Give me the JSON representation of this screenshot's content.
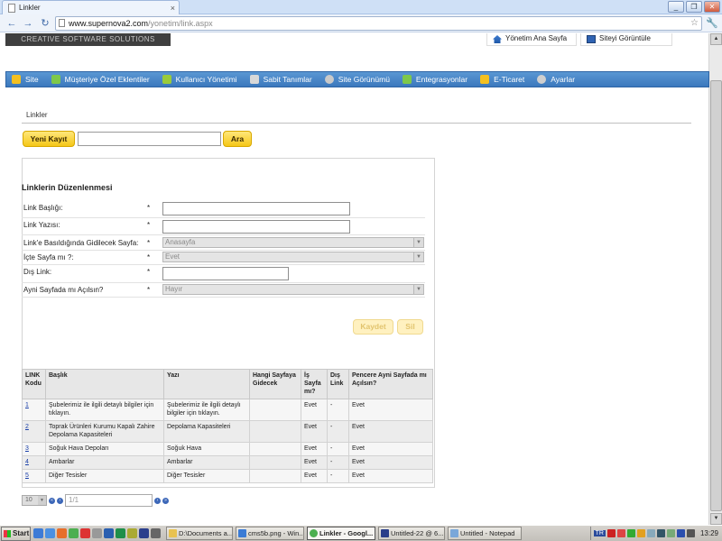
{
  "browser": {
    "tab_title": "Linkler",
    "tab_close": "×",
    "url_domain": "www.supernova2.com",
    "url_path": "/yonetim/link.aspx",
    "window_buttons": [
      "_",
      "❐",
      "✕"
    ]
  },
  "header": {
    "brand": "CREATIVE SOFTWARE SOLUTIONS",
    "admin_home": "Yönetim Ana Sayfa",
    "view_site": "Siteyi Görüntüle"
  },
  "menu": {
    "items": [
      {
        "label": "Site",
        "icon_color": "#f4c020"
      },
      {
        "label": "Müşteriye Özel Eklentiler",
        "icon_color": "#7ec84a"
      },
      {
        "label": "Kullanıcı Yönetimi",
        "icon_color": "#9acb3a"
      },
      {
        "label": "Sabit Tanımlar",
        "icon_color": "#d8d8d8"
      },
      {
        "label": "Site Görünümü",
        "icon_color": "#c9c9c9"
      },
      {
        "label": "Entegrasyonlar",
        "icon_color": "#7ec84a"
      },
      {
        "label": "E-Ticaret",
        "icon_color": "#f4c020"
      },
      {
        "label": "Ayarlar",
        "icon_color": "#cfcfcf"
      }
    ]
  },
  "page": {
    "breadcrumb": "Linkler",
    "new_button": "Yeni Kayıt",
    "search_button": "Ara",
    "search_value": ""
  },
  "form": {
    "title": "Linklerin Düzenlenmesi",
    "link_title_label": "Link Başlığı:",
    "link_text_label": "Link Yazısı:",
    "target_page_label": "Link'e Basıldığında Gidilecek Sayfa:",
    "target_page_value": "Anasayfa",
    "internal_label": "İçte Sayfa mı ?:",
    "internal_value": "Evet",
    "external_label": "Dış Link:",
    "same_window_label": "Ayni Sayfada mı Açılsın?",
    "same_window_value": "Hayır",
    "required_mark": "*",
    "save_button": "Kaydet",
    "delete_button": "Sil"
  },
  "table": {
    "headers": [
      "LINK Kodu",
      "Başlık",
      "Yazı",
      "Hangi Sayfaya Gidecek",
      "İş Sayfa mı?",
      "Dış Link",
      "Pencere Ayni Sayfada mı Açılsın?"
    ],
    "rows": [
      {
        "id": "1",
        "title": "Şubelerimiz ile ilgili detaylı bilgiler için tıklayın.",
        "text": "Şubelerimiz ile ilgili detaylı bilgiler için tıklayın.",
        "page": "",
        "internal": "Evet",
        "external": "-",
        "same_window": "Evet"
      },
      {
        "id": "2",
        "title": "Toprak Ürünleri Kurumu Kapalı Zahire Depolama Kapasiteleri",
        "text": "Depolama Kapasiteleri",
        "page": "",
        "internal": "Evet",
        "external": "-",
        "same_window": "Evet"
      },
      {
        "id": "3",
        "title": "Soğuk Hava Depoları",
        "text": "Soğuk Hava",
        "page": "",
        "internal": "Evet",
        "external": "-",
        "same_window": "Evet"
      },
      {
        "id": "4",
        "title": "Ambarlar",
        "text": "Ambarlar",
        "page": "",
        "internal": "Evet",
        "external": "-",
        "same_window": "Evet"
      },
      {
        "id": "5",
        "title": "Diğer Tesisler",
        "text": "Diğer Tesisler",
        "page": "",
        "internal": "Evet",
        "external": "-",
        "same_window": "Evet"
      }
    ]
  },
  "pager": {
    "page_size": "10",
    "page_info": "1/1",
    "first": "«",
    "prev": "‹",
    "next": "›",
    "last": "»"
  },
  "taskbar": {
    "start": "Start",
    "tasks": [
      {
        "label": "D:\\Documents a...",
        "icon_color": "#e8c251"
      },
      {
        "label": "cms5b.png - Win...",
        "icon_color": "#3a7bd5"
      },
      {
        "label": "Linkler - Googl...",
        "icon_color": "#4caf50"
      },
      {
        "label": "Untitled-22 @ 6...",
        "icon_color": "#2a3e8a"
      },
      {
        "label": "Untitled - Notepad",
        "icon_color": "#7aa7d9"
      }
    ],
    "lang": "TR",
    "clock": "13:29"
  }
}
